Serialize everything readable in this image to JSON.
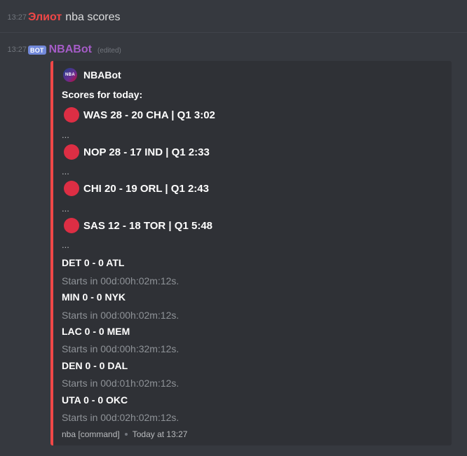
{
  "messages": [
    {
      "timestamp": "13:27",
      "author": "Элиот",
      "text": "nba scores"
    },
    {
      "timestamp": "13:27",
      "bot_badge": "BOT",
      "author": "NBABot",
      "edited": "(edited)"
    }
  ],
  "embed": {
    "accent_color": "#f04747",
    "author_icon_label": "NBA",
    "author_name": "NBABot",
    "title_line": "Scores for today:",
    "live_games": [
      {
        "text": "WAS 28 - 20 CHA | Q1 3:02",
        "trailer": "..."
      },
      {
        "text": "NOP 28 - 17 IND | Q1 2:33",
        "trailer": "..."
      },
      {
        "text": "CHI 20 - 19 ORL | Q1 2:43",
        "trailer": "..."
      },
      {
        "text": "SAS 12 - 18 TOR | Q1 5:48",
        "trailer": "..."
      }
    ],
    "upcoming_games": [
      {
        "matchup": "DET 0 - 0 ATL",
        "starts": "Starts in 00d:00h:02m:12s."
      },
      {
        "matchup": "MIN 0 - 0 NYK",
        "starts": "Starts in 00d:00h:02m:12s."
      },
      {
        "matchup": "LAC 0 - 0 MEM",
        "starts": "Starts in 00d:00h:32m:12s."
      },
      {
        "matchup": "DEN 0 - 0 DAL",
        "starts": "Starts in 00d:01h:02m:12s."
      },
      {
        "matchup": "UTA 0 - 0 OKC",
        "starts": "Starts in 00d:02h:02m:12s."
      }
    ],
    "footer_text": "nba [command]",
    "footer_time": "Today at 13:27"
  },
  "icons": {
    "live_indicator": "red-circle-icon",
    "author_icon": "nba-logo-icon"
  }
}
